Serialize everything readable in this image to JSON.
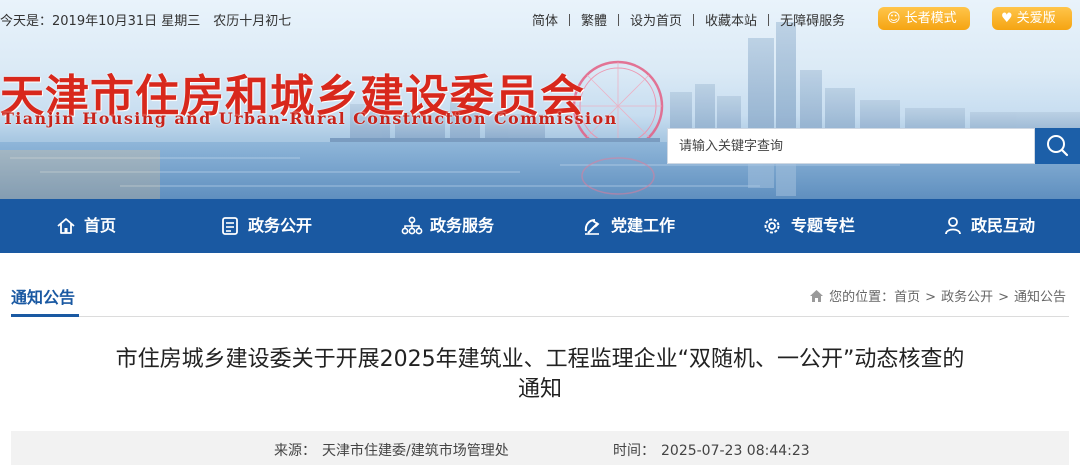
{
  "topbar": {
    "date": "今天是：2019年10月31日 星期三　农历十月初七",
    "links": [
      "简体",
      "繁體",
      "设为首页",
      "收藏本站",
      "无障碍服务"
    ],
    "elder_mode": "长者模式",
    "care_edition": "关爱版"
  },
  "header": {
    "title_cn": "天津市住房和城乡建设委员会",
    "title_en": "Tianjin Housing and Urban-Rural Construction Commission"
  },
  "search": {
    "placeholder": "请输入关键字查询",
    "icon": "search-icon"
  },
  "nav": {
    "items": [
      {
        "label": "首页",
        "icon": "home-icon"
      },
      {
        "label": "政务公开",
        "icon": "document-icon"
      },
      {
        "label": "政务服务",
        "icon": "network-icon"
      },
      {
        "label": "党建工作",
        "icon": "party-emblem-icon"
      },
      {
        "label": "专题专栏",
        "icon": "gear-icon"
      },
      {
        "label": "政民互动",
        "icon": "user-icon"
      }
    ]
  },
  "section": {
    "title": "通知公告",
    "breadcrumb": {
      "prefix": "您的位置：",
      "items": [
        "首页",
        "政务公开",
        "通知公告"
      ],
      "separator": ">"
    }
  },
  "article": {
    "title": "市住房城乡建设委关于开展2025年建筑业、工程监理企业“双随机、一公开”动态核查的通知",
    "source_label": "来源：",
    "source": "天津市住建委/建筑市场管理处",
    "time_label": "时间：",
    "time": "2025-07-23 08:44:23"
  },
  "colors": {
    "nav_bg": "#1a59a2",
    "title_red": "#d8281c",
    "mode_button": "#f5a412",
    "search_button": "#1c5fa8"
  }
}
